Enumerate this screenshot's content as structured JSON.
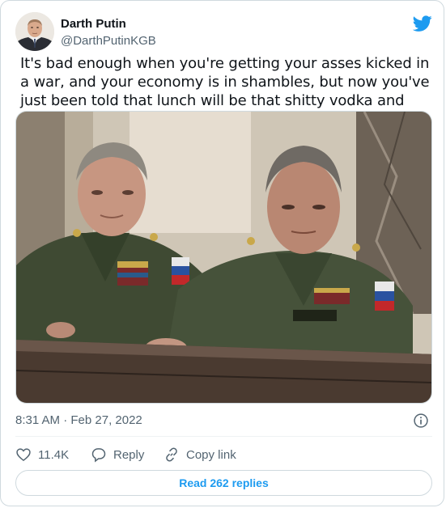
{
  "author": {
    "name": "Darth Putin",
    "handle": "@DarthPutinKGB"
  },
  "icons": {
    "brand": "twitter-bird-icon",
    "info": "info-icon",
    "like": "heart-icon",
    "reply": "speech-bubble-icon",
    "copy": "link-icon"
  },
  "colors": {
    "brand": "#1d9bf0",
    "secondary_text": "#536471",
    "primary_text": "#0f1419",
    "border": "#cfd9de"
  },
  "tweet": {
    "text": "It's bad enough when you're getting your asses kicked in a war, and your economy is in shambles, but now you've just been told that lunch will be that shitty vodka and Lutefisk.",
    "timestamp": "8:31 AM · Feb 27, 2022"
  },
  "actions": {
    "likes": "11.4K",
    "reply_label": "Reply",
    "copy_label": "Copy link"
  },
  "footer": {
    "read_replies_label": "Read 262 replies"
  }
}
